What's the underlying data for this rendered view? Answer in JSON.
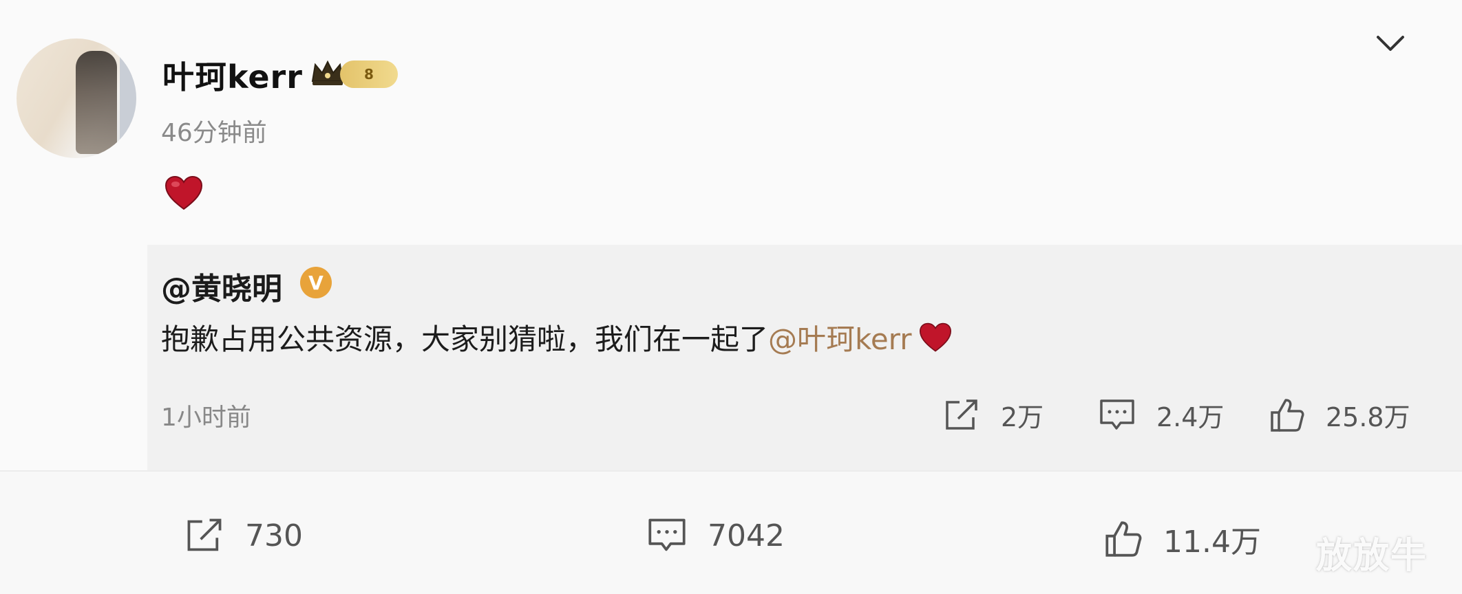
{
  "post": {
    "author": "叶珂kerr",
    "level_badge": "8",
    "time": "46分钟前",
    "content_icon": "heart-icon"
  },
  "repost": {
    "author": "@黄晓明",
    "verified_badge": "V",
    "text_before": "抱歉占用公共资源，大家别猜啦，我们在一起了",
    "mention": "@叶珂kerr",
    "time": "1小时前",
    "shares": "2万",
    "comments": "2.4万",
    "likes": "25.8万"
  },
  "footer": {
    "shares": "730",
    "comments": "7042",
    "likes": "11.4万"
  },
  "watermark": "放放牛",
  "colors": {
    "mention": "#a57b52",
    "heart": "#c0152a",
    "verified": "#e8a33a",
    "badge_gold": "#e3c36a"
  }
}
